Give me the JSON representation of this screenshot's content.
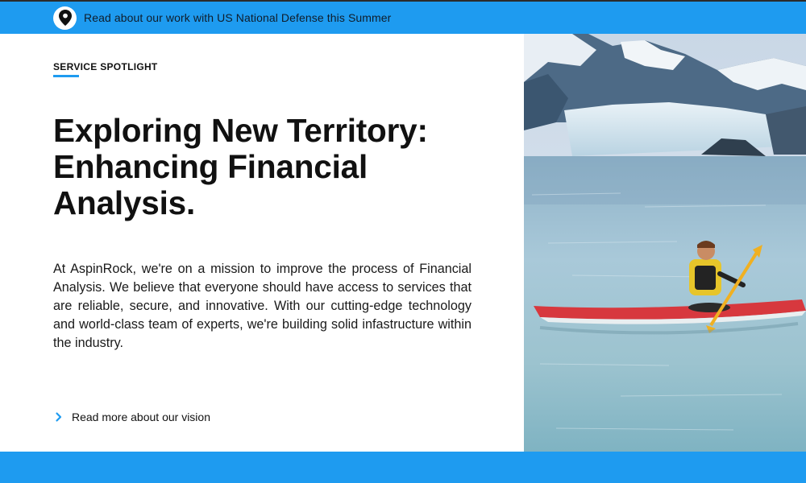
{
  "announcement": {
    "text": "Read about our work with US National Defense this Summer",
    "icon": "location-pin-icon"
  },
  "spotlight": {
    "eyebrow": "SERVICE SPOTLIGHT",
    "headline": "Exploring New Territory: Enhancing Financial Analysis.",
    "body": "At AspinRock, we're on a mission to improve the process of Financial Analysis. We believe that everyone should have access to services that are reliable, secure, and innovative. With our cutting-edge technology and world-class team of experts, we're building solid infastructure within the industry.",
    "cta_label": "Read more about our vision",
    "cta_icon": "chevron-right-icon"
  },
  "hero": {
    "subject": "kayaker-glacier-photo"
  },
  "colors": {
    "accent": "#1e9bf0",
    "text": "#111111",
    "background": "#ffffff"
  }
}
